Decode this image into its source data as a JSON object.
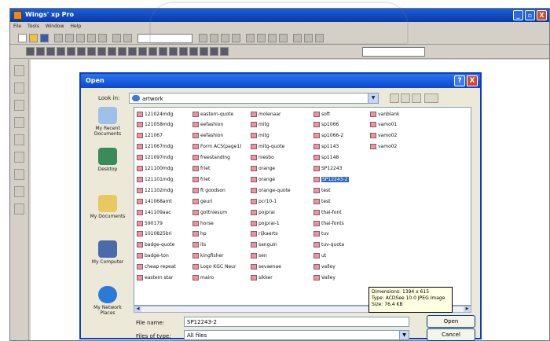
{
  "app": {
    "title": "Wings' xp Pro",
    "menus": [
      "File",
      "Tools",
      "Window",
      "Help"
    ],
    "window_buttons": [
      "_",
      "▫",
      "X"
    ]
  },
  "dialog": {
    "title": "Open",
    "help": "?",
    "close": "X",
    "look_in_label": "Look in:",
    "look_in_value": "artwork",
    "places": [
      "My Recent Documents",
      "Desktop",
      "My Documents",
      "My Computer",
      "My Network Places"
    ],
    "files": [
      [
        "121024mdg",
        "121058mdg",
        "121067",
        "121067mdg",
        "121097mdg",
        "121100mdg",
        "121101mdg",
        "121102mdg",
        "141068amt",
        "141109aac",
        "590179",
        "1010825bri",
        "badge-quote",
        "badge-ton",
        "cheap repeat",
        "eastern star"
      ],
      [
        "eastern-quote",
        "eefashion",
        "eefashion",
        "Form ACS(page1)",
        "freestanding",
        "friet",
        "friet",
        "ft goodson",
        "geuri",
        "gottniesum",
        "horse",
        "hp",
        "its",
        "kingfisher",
        "Logo KGC Neur",
        "mairo"
      ],
      [
        "molenaar",
        "mitg",
        "mitg",
        "mitg-quote",
        "niesbo",
        "orange",
        "orange",
        "orange-quote",
        "pcr10-1",
        "pojprai",
        "pojprai-1",
        "rijkaerts",
        "sanguin",
        "sen",
        "sevaenae",
        "sikker"
      ],
      [
        "soft",
        "sp1066",
        "sp1066-2",
        "sp1143",
        "sp1148",
        "SP12243",
        "SP12243-2",
        "test",
        "test",
        "thai-font",
        "thai-fonts",
        "tuv",
        "tuv-quota",
        "ut",
        "valley",
        "Valley"
      ],
      [
        "vanblank",
        "vamo01",
        "vamo02",
        "vamo02"
      ]
    ],
    "selected_file": "SP12243-2",
    "tooltip": {
      "dimensions": "Dimensions: 1394 x 615",
      "type": "Type: ACDSee 10.0 JPEG Image",
      "size": "Size: 76.4 KB"
    },
    "file_name_label": "File name:",
    "file_name_value": "SP12243-2",
    "files_of_type_label": "Files of type:",
    "files_of_type_value": "All files",
    "open_button": "Open",
    "cancel_button": "Cancel"
  }
}
